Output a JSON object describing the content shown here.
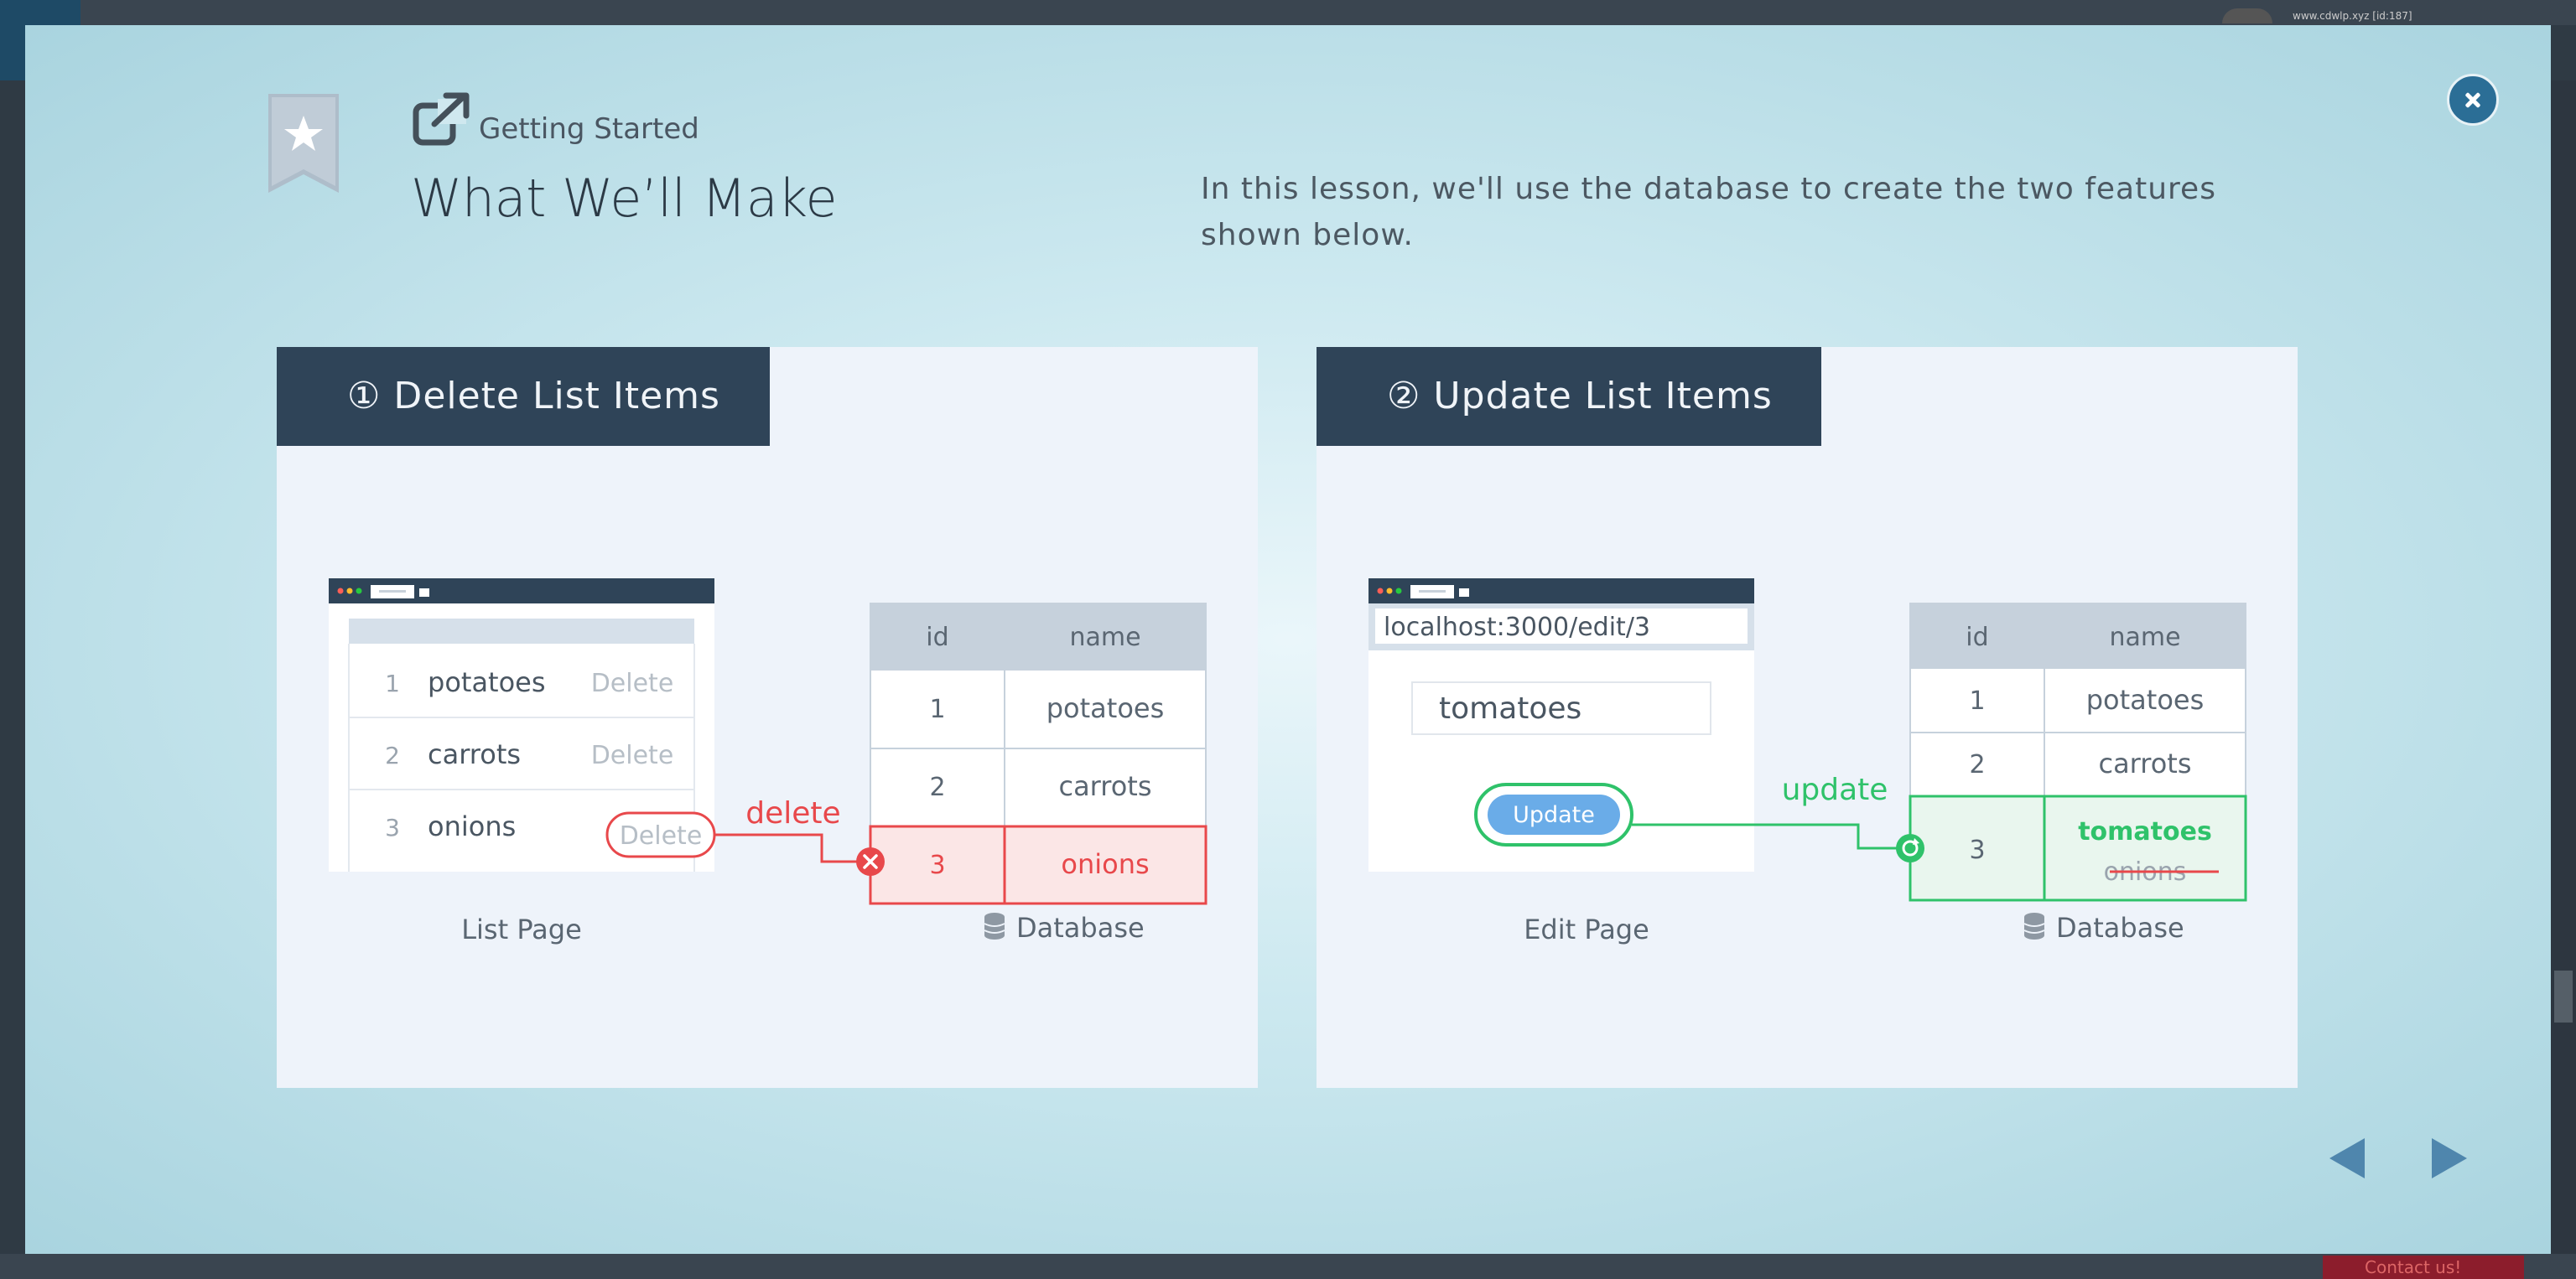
{
  "background": {
    "user_text": "www.cdwlp.xyz [id:187]",
    "contact_label": "Contact us!"
  },
  "lesson": {
    "category": "Getting Started",
    "title": "What We’ll Make",
    "intro": "In this lesson, we'll use the database to create the two features shown below."
  },
  "colors": {
    "header_bg": "#2f4458",
    "delete_red": "#e8484b",
    "update_green": "#2fc26a",
    "accent_blue": "#2b6e96"
  },
  "panels": [
    {
      "header": "① Delete List Items",
      "list_page": {
        "caption": "List Page",
        "rows": [
          {
            "num": "1",
            "name": "potatoes",
            "action": "Delete"
          },
          {
            "num": "2",
            "name": "carrots",
            "action": "Delete"
          },
          {
            "num": "3",
            "name": "onions",
            "action": "Delete"
          }
        ]
      },
      "arrow_label": "delete",
      "database": {
        "caption": "Database",
        "columns": [
          "id",
          "name"
        ],
        "rows": [
          {
            "id": "1",
            "name": "potatoes"
          },
          {
            "id": "2",
            "name": "carrots"
          },
          {
            "id": "3",
            "name": "onions"
          }
        ]
      }
    },
    {
      "header": "② Update List Items",
      "edit_page": {
        "caption": "Edit Page",
        "url": "localhost:3000/edit/3",
        "input_value": "tomatoes",
        "button_label": "Update"
      },
      "arrow_label": "update",
      "database": {
        "caption": "Database",
        "columns": [
          "id",
          "name"
        ],
        "rows": [
          {
            "id": "1",
            "name": "potatoes"
          },
          {
            "id": "2",
            "name": "carrots"
          },
          {
            "id": "3",
            "name": "tomatoes",
            "old_name": "onions"
          }
        ]
      }
    }
  ],
  "nav": {
    "prev_icon": "triangle-left-icon",
    "next_icon": "triangle-right-icon"
  }
}
